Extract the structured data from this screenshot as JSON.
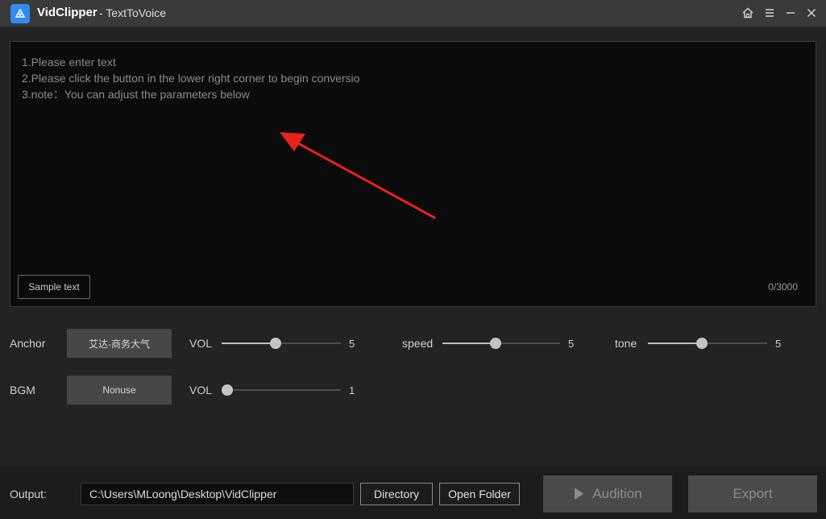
{
  "titlebar": {
    "app_name": "VidClipper",
    "subtitle": "- TextToVoice",
    "icons": [
      "home-icon",
      "menu-icon",
      "minimize-icon",
      "close-icon"
    ]
  },
  "editor": {
    "placeholder": "1.Please enter text\n2.Please click the button in the lower right corner to begin conversio\n3.note：You can adjust the parameters below",
    "sample_button": "Sample text",
    "char_count": "0/3000",
    "annotation_color": "#e8221b"
  },
  "params": {
    "anchor": {
      "label": "Anchor",
      "voice": "艾达-商务大气",
      "vol_label": "VOL",
      "vol_value": "5",
      "vol_fraction": 0.45,
      "speed_label": "speed",
      "speed_value": "5",
      "speed_fraction": 0.45,
      "tone_label": "tone",
      "tone_value": "5",
      "tone_fraction": 0.45
    },
    "bgm": {
      "label": "BGM",
      "track": "Nonuse",
      "vol_label": "VOL",
      "vol_value": "1",
      "vol_fraction": 0.05
    }
  },
  "bottom": {
    "output_label": "Output:",
    "output_path": "C:\\Users\\MLoong\\Desktop\\VidClipper",
    "directory_button": "Directory",
    "open_folder_button": "Open Folder",
    "audition_button": "Audition",
    "export_button": "Export"
  },
  "colors": {
    "accent": "#2f8cf0",
    "background": "#232323",
    "editor_bg": "#0b0b0b"
  }
}
